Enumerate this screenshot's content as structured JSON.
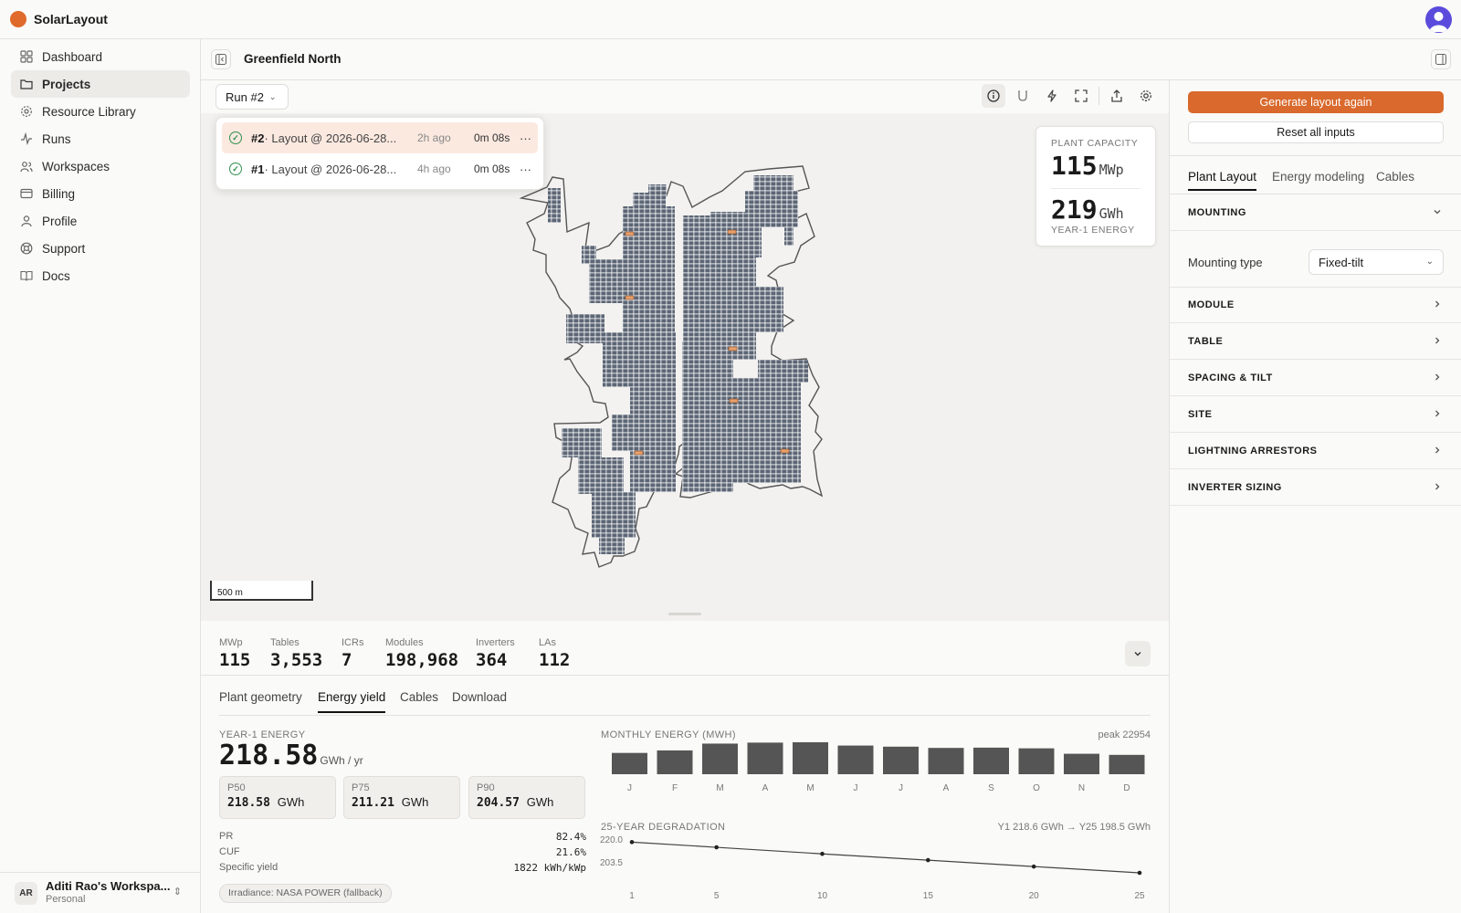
{
  "app": {
    "name": "SolarLayout"
  },
  "sidebar": {
    "items": [
      {
        "label": "Dashboard",
        "icon": "grid-icon"
      },
      {
        "label": "Projects",
        "icon": "folder-icon",
        "active": true
      },
      {
        "label": "Resource Library",
        "icon": "gear-icon"
      },
      {
        "label": "Runs",
        "icon": "activity-icon"
      },
      {
        "label": "Workspaces",
        "icon": "users-icon"
      },
      {
        "label": "Billing",
        "icon": "card-icon"
      },
      {
        "label": "Profile",
        "icon": "user-icon"
      },
      {
        "label": "Support",
        "icon": "lifebuoy-icon"
      },
      {
        "label": "Docs",
        "icon": "book-icon"
      }
    ],
    "workspace": {
      "initials": "AR",
      "name": "Aditi Rao's Workspa...",
      "type": "Personal"
    }
  },
  "header": {
    "project_title": "Greenfield North"
  },
  "toolbar": {
    "run_select": "Run #2"
  },
  "runs": [
    {
      "num": "#2",
      "label": "· Layout @ 2026-06-28...",
      "ago": "2h ago",
      "duration": "0m 08s",
      "selected": true
    },
    {
      "num": "#1",
      "label": "· Layout @ 2026-06-28...",
      "ago": "4h ago",
      "duration": "0m 08s",
      "selected": false
    }
  ],
  "capacity_card": {
    "plant_label": "PLANT CAPACITY",
    "plant_value": "115",
    "plant_unit": "MWp",
    "energy_value": "219",
    "energy_unit": "GWh",
    "energy_label": "YEAR-1 ENERGY"
  },
  "scale": "500 m",
  "stats": [
    {
      "label": "MWp",
      "value": "115"
    },
    {
      "label": "Tables",
      "value": "3,553"
    },
    {
      "label": "ICRs",
      "value": "7"
    },
    {
      "label": "Modules",
      "value": "198,968"
    },
    {
      "label": "Inverters",
      "value": "364"
    },
    {
      "label": "LAs",
      "value": "112"
    }
  ],
  "bottom_tabs": [
    "Plant geometry",
    "Energy yield",
    "Cables",
    "Download"
  ],
  "energy": {
    "year1_label": "YEAR-1 ENERGY",
    "year1_value": "218.58",
    "year1_unit": "GWh / yr",
    "p": [
      {
        "label": "P50",
        "value": "218.58",
        "unit": "GWh"
      },
      {
        "label": "P75",
        "value": "211.21",
        "unit": "GWh"
      },
      {
        "label": "P90",
        "value": "204.57",
        "unit": "GWh"
      }
    ],
    "metrics": [
      {
        "label": "PR",
        "value": "82.4%"
      },
      {
        "label": "CUF",
        "value": "21.6%"
      },
      {
        "label": "Specific yield",
        "value": "1822 kWh/kWp"
      }
    ],
    "irradiance_chip": "Irradiance: NASA POWER (fallback)",
    "monthly_label": "MONTHLY ENERGY (MWH)",
    "monthly_peak": "peak 22954",
    "degradation_label": "25-YEAR DEGRADATION",
    "degradation_info": "Y1 218.6 GWh → Y25 198.5 GWh"
  },
  "chart_data": [
    {
      "type": "bar",
      "title": "MONTHLY ENERGY (MWH)",
      "categories": [
        "J",
        "F",
        "M",
        "A",
        "M",
        "J",
        "J",
        "A",
        "S",
        "O",
        "N",
        "D"
      ],
      "values": [
        15300,
        17100,
        22000,
        22700,
        22954,
        20600,
        19800,
        18900,
        19100,
        18600,
        14700,
        13900
      ],
      "ylim": [
        0,
        22954
      ]
    },
    {
      "type": "line",
      "title": "25-YEAR DEGRADATION",
      "x": [
        1,
        5,
        10,
        15,
        20,
        25
      ],
      "y": [
        218.6,
        215.2,
        210.9,
        206.8,
        202.6,
        198.5
      ],
      "xticks": [
        1,
        5,
        10,
        15,
        20,
        25
      ],
      "yticks": [
        "220.0",
        "203.5"
      ],
      "ylim": [
        198.5,
        220.0
      ]
    }
  ],
  "right_panel": {
    "generate_label": "Generate layout again",
    "reset_label": "Reset all inputs",
    "tabs": [
      "Plant Layout",
      "Energy modeling",
      "Cables"
    ],
    "sections": [
      "MOUNTING",
      "MODULE",
      "TABLE",
      "SPACING & TILT",
      "SITE",
      "LIGHTNING ARRESTORS",
      "INVERTER SIZING"
    ],
    "mounting_type_label": "Mounting type",
    "mounting_type_value": "Fixed-tilt"
  },
  "colors": {
    "accent": "#d9692c",
    "panel": "#5b6472",
    "bar": "#555555"
  }
}
